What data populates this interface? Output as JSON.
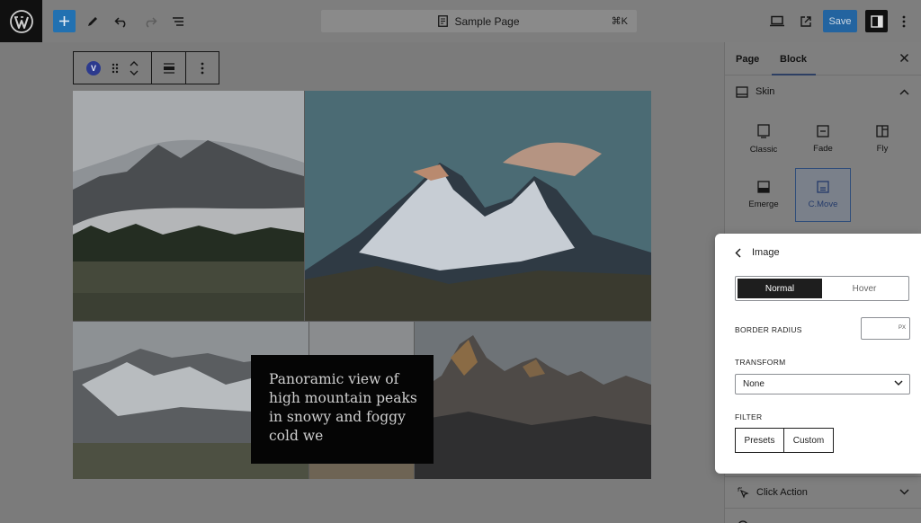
{
  "topbar": {
    "document_title": "Sample Page",
    "shortcut": "⌘K",
    "save_label": "Save"
  },
  "block_toolbar": {
    "block_badge": "V"
  },
  "gallery": {
    "caption": "Panoramic view of high mountain peaks in snowy and foggy cold we"
  },
  "sidebar": {
    "tabs": [
      {
        "label": "Page"
      },
      {
        "label": "Block"
      }
    ],
    "active_tab": "Block",
    "section_title": "Skin",
    "skins": [
      {
        "label": "Classic"
      },
      {
        "label": "Fade"
      },
      {
        "label": "Fly"
      },
      {
        "label": "Emerge"
      },
      {
        "label": "C.Move"
      }
    ],
    "selected_skin": "C.Move",
    "click_action_label": "Click Action"
  },
  "popover": {
    "title": "Image",
    "states": [
      {
        "label": "Normal"
      },
      {
        "label": "Hover"
      }
    ],
    "active_state": "Normal",
    "border_radius_label": "BORDER RADIUS",
    "border_radius_value": "",
    "border_radius_unit": "PX",
    "transform_label": "TRANSFORM",
    "transform_value": "None",
    "filter_label": "FILTER",
    "filter_buttons": [
      {
        "label": "Presets"
      },
      {
        "label": "Custom"
      }
    ]
  },
  "colors": {
    "accent": "#2271b1",
    "selected_skin_border": "#2f4d7a",
    "overlay_gray": "#7b7b7b"
  },
  "icons": [
    "wordpress-icon",
    "plus-icon",
    "pen-icon",
    "undo-icon",
    "redo-icon",
    "list-view-icon",
    "page-icon",
    "desktop-icon",
    "external-link-icon",
    "sidebar-toggle-icon",
    "more-vertical-icon",
    "drag-handle-icon",
    "chevron-up-icon",
    "chevron-down-icon",
    "align-icon",
    "close-icon",
    "skin-icon",
    "chevron-left-icon",
    "pointer-click-icon"
  ]
}
